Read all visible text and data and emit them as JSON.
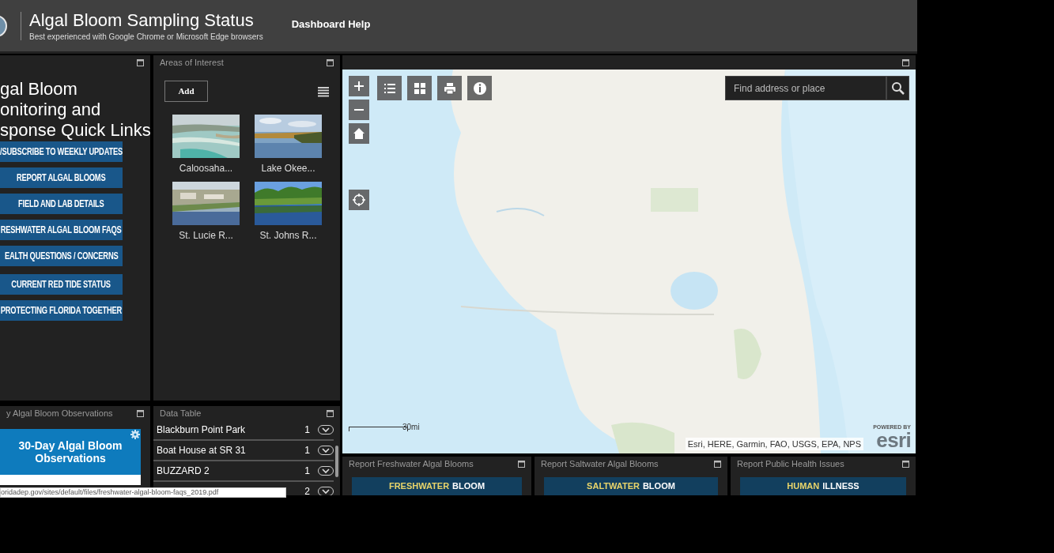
{
  "header": {
    "title": "Algal Bloom Sampling Status",
    "subtitle": "Best experienced with Google Chrome or Microsoft Edge browsers",
    "help_link": "Dashboard Help"
  },
  "quick_links": {
    "heading_lines": [
      "gal Bloom",
      "onitoring and",
      "sponse Quick Links"
    ],
    "buttons": [
      "/SUBSCRIBE TO WEEKLY UPDATES",
      "REPORT ALGAL BLOOMS",
      "FIELD AND LAB DETAILS",
      "RESHWATER ALGAL BLOOM FAQS",
      "EALTH QUESTIONS / CONCERNS",
      "CURRENT RED TIDE STATUS",
      "PROTECTING FLORIDA TOGETHER"
    ]
  },
  "areas_of_interest": {
    "title": "Areas of Interest",
    "add_button": "Add",
    "items": [
      {
        "label": "Caloosaha...",
        "kind": "coast"
      },
      {
        "label": "Lake Okee...",
        "kind": "marsh"
      },
      {
        "label": "St. Lucie R...",
        "kind": "town"
      },
      {
        "label": "St. Johns R...",
        "kind": "river"
      }
    ]
  },
  "observations": {
    "title": "y Algal Bloom Observations",
    "card_title": "30-Day Algal Bloom Observations"
  },
  "data_table": {
    "title": "Data Table",
    "rows": [
      {
        "name": "Blackburn Point Park",
        "count": "1"
      },
      {
        "name": "Boat House at SR 31",
        "count": "1"
      },
      {
        "name": "BUZZARD 2",
        "count": "1"
      },
      {
        "count": "2"
      }
    ]
  },
  "map": {
    "search": {
      "placeholder": "Find address or place"
    },
    "scale": "30mi",
    "attribution": "Esri, HERE, Garmin, FAO, USGS, EPA, NPS",
    "logo_small": "POWERED BY",
    "logo": "esri"
  },
  "report_panels": [
    {
      "title": "Report Freshwater Algal Blooms",
      "highlight": "FRESHWATER",
      "rest": "BLOOM"
    },
    {
      "title": "Report Saltwater Algal Blooms",
      "highlight": "SALTWATER",
      "rest": "BLOOM"
    },
    {
      "title": "Report Public Health Issues",
      "highlight": "HUMAN",
      "rest": "ILLNESS"
    }
  ],
  "status_url": "oridadep.gov/sites/default/files/freshwater-algal-bloom-faqs_2019.pdf"
}
